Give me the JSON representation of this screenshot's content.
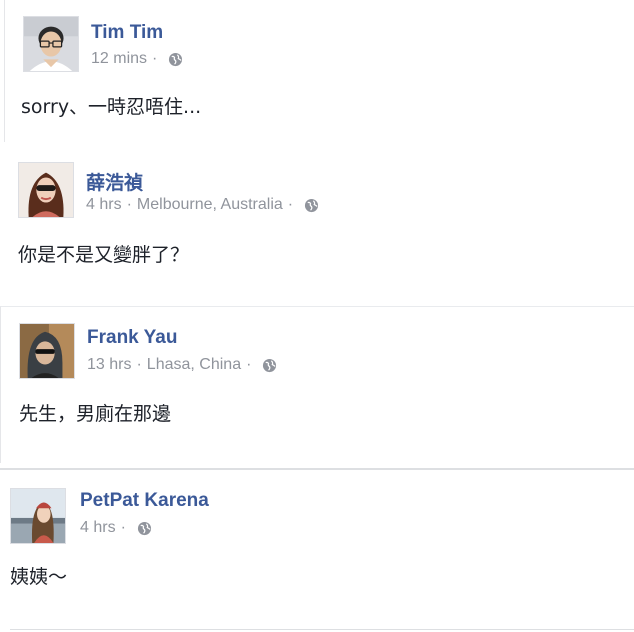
{
  "comments": [
    {
      "author": "Tim Tim",
      "time": "12 mins",
      "location": "",
      "text": "sorry、一時忍唔住..."
    },
    {
      "author": "薛浩禎",
      "time": "4 hrs",
      "location": "Melbourne, Australia",
      "text": "你是不是又變胖了？"
    },
    {
      "author": "Frank Yau",
      "time": "13 hrs",
      "location": "Lhasa, China",
      "text": "先生，男廁在那邊"
    },
    {
      "author": "PetPat Karena",
      "time": "4 hrs",
      "location": "",
      "text": "姨姨～"
    }
  ],
  "separator": "·",
  "colors": {
    "author_link": "#3b5998",
    "meta_text": "#90949c",
    "body_text": "#1d2129",
    "divider": "#dddfe2"
  },
  "icons": {
    "privacy": "globe-icon"
  }
}
